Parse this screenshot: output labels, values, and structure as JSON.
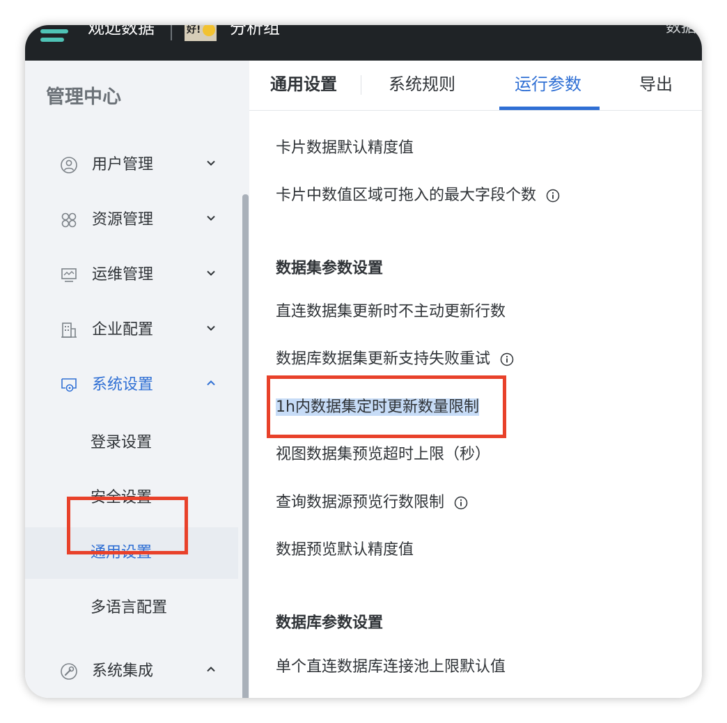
{
  "header": {
    "app_title": "观远数据",
    "avatar_text": "好!",
    "group_name": "分析组",
    "right_text": "数据"
  },
  "sidebar": {
    "title": "管理中心",
    "items": [
      {
        "label": "用户管理",
        "icon": "user-icon",
        "expanded": false
      },
      {
        "label": "资源管理",
        "icon": "grid-icon",
        "expanded": false
      },
      {
        "label": "运维管理",
        "icon": "monitor-icon",
        "expanded": false
      },
      {
        "label": "企业配置",
        "icon": "building-icon",
        "expanded": false
      },
      {
        "label": "系统设置",
        "icon": "settings-icon",
        "expanded": true
      },
      {
        "label": "系统集成",
        "icon": "integration-icon",
        "expanded": true
      }
    ],
    "subitems": [
      {
        "label": "登录设置"
      },
      {
        "label": "安全设置"
      },
      {
        "label": "通用设置",
        "selected": true
      },
      {
        "label": "多语言配置"
      }
    ]
  },
  "tabs": [
    {
      "label": "通用设置"
    },
    {
      "label": "系统规则"
    },
    {
      "label": "运行参数",
      "active": true
    },
    {
      "label": "导出"
    }
  ],
  "content": {
    "rows": [
      {
        "label": "卡片数据默认精度值"
      },
      {
        "label": "卡片中数值区域可拖入的最大字段个数",
        "info": true
      },
      {
        "label": "数据集参数设置",
        "section": true
      },
      {
        "label": "直连数据集更新时不主动更新行数"
      },
      {
        "label": "数据库数据集更新支持失败重试",
        "info": true
      },
      {
        "label": "1h内数据集定时更新数量限制",
        "highlighted": true
      },
      {
        "label": "视图数据集预览超时上限（秒）"
      },
      {
        "label": "查询数据源预览行数限制",
        "info": true
      },
      {
        "label": "数据预览默认精度值"
      },
      {
        "label": "数据库参数设置",
        "section": true
      },
      {
        "label": "单个直连数据库连接池上限默认值"
      }
    ]
  },
  "colors": {
    "accent": "#2f6fd4",
    "annotation": "#e8412a",
    "selection": "#c7dcf7"
  }
}
